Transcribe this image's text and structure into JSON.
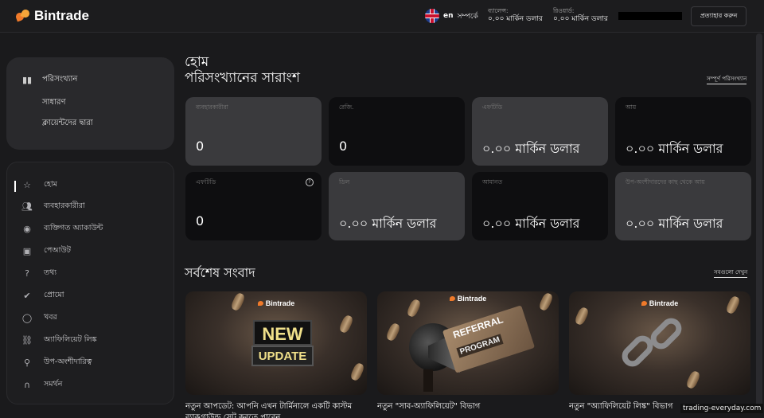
{
  "header": {
    "brand": "Bintrade",
    "lang_code": "en",
    "lang_label": "সম্পর্কে",
    "balance_label": "ব্যালেন্স:",
    "balance_value": "০.০০ মার্কিন ডলার",
    "bonus_label": "রিওয়ার্ড:",
    "bonus_value": "০.০০ মার্কিন ডলার",
    "withdraw_button": "প্রত্যাহার করুন"
  },
  "sidebar_top": {
    "items": [
      {
        "label": "পরিসংখ্যান",
        "icon": "bar-chart-icon"
      },
      {
        "label": "সাধারণ"
      },
      {
        "label": "ক্লায়েন্টদের দ্বারা"
      }
    ]
  },
  "sidebar_nav": {
    "items": [
      {
        "label": "হোম",
        "icon": "star-icon",
        "active": true
      },
      {
        "label": "ব্যবহারকারীরা",
        "icon": "users-icon"
      },
      {
        "label": "ব্যক্তিগত অ্যাকাউন্ট",
        "icon": "account-icon"
      },
      {
        "label": "পেআউট",
        "icon": "wallet-icon"
      },
      {
        "label": "তথ্য",
        "icon": "help-icon"
      },
      {
        "label": "প্রোমো",
        "icon": "badge-icon"
      },
      {
        "label": "খবর",
        "icon": "chat-icon"
      },
      {
        "label": "অ্যাফিলিয়েট লিঙ্ক",
        "icon": "link-icon"
      },
      {
        "label": "উপ-অংশীদারিত্ব",
        "icon": "add-user-icon"
      },
      {
        "label": "সমর্থন",
        "icon": "headset-icon"
      }
    ]
  },
  "main": {
    "breadcrumb": "হোম",
    "title": "পরিসংখ্যানের সারাংশ",
    "full_stats_link": "সম্পূর্ণ পরিসংখ্যান",
    "cards": [
      {
        "label": "ব্যবহারকারীরা",
        "value": "0"
      },
      {
        "label": "রেজি.",
        "value": "0"
      },
      {
        "label": "এফটিডি",
        "value": "০.০০ মার্কিন ডলার"
      },
      {
        "label": "আয়",
        "value": "০.০০ মার্কিন ডলার"
      },
      {
        "label": "এফটিডি",
        "value": "0"
      },
      {
        "label": "ডিল",
        "value": "০.০০ মার্কিন ডলার"
      },
      {
        "label": "আমানত",
        "value": "০.০০ মার্কিন ডলার"
      },
      {
        "label": "উপ-অংশীদারদের কাছ থেকে আয়",
        "value": "০.০০ মার্কিন ডলার"
      }
    ],
    "news_title": "সর্বশেষ সংবাদ",
    "see_all": "সবগুলো দেখুন",
    "news": [
      {
        "brand": "Bintrade",
        "img_line1": "NEW",
        "img_line2": "UPDATE",
        "caption": "নতুন আপডেট: আপনি এখন টার্মিনালে একটি কাস্টম",
        "caption2": "ব্যাকগ্রাউন্ড সেট করতে পারেন"
      },
      {
        "brand": "Bintrade",
        "img_line1": "REFERRAL",
        "img_line2": "PROGRAM",
        "caption": "নতুন \"সাব-অ্যাফিলিয়েট\" বিভাগ"
      },
      {
        "brand": "Bintrade",
        "caption": "নতুন \"অ্যাফিলিয়েট লিঙ্ক\" বিভাগ"
      }
    ]
  },
  "watermark": "trading-everyday.com"
}
